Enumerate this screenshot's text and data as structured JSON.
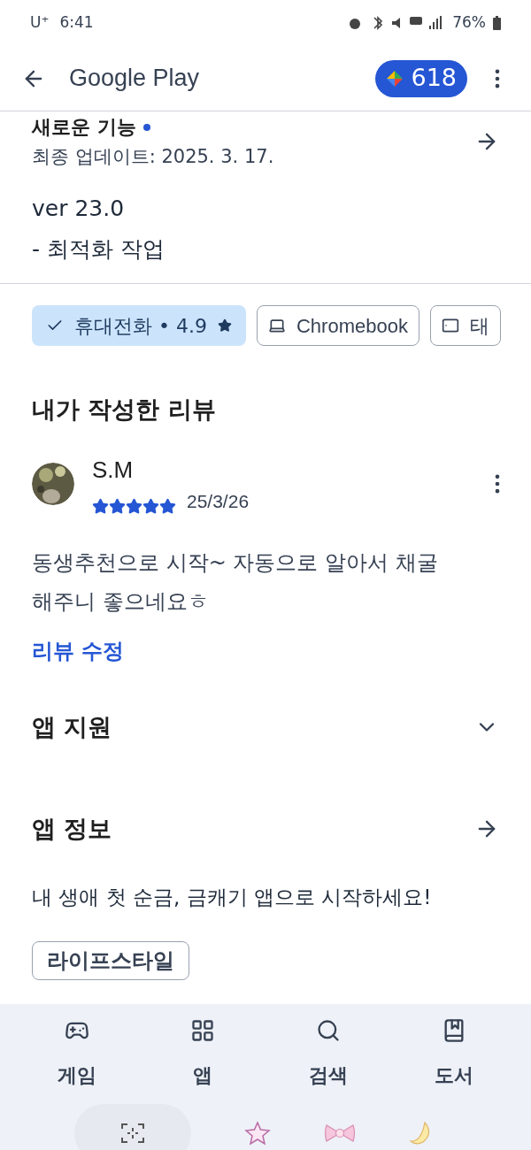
{
  "status_bar": {
    "carrier": "U⁺",
    "time": "6:41",
    "battery": "76%"
  },
  "header": {
    "title": "Google Play",
    "points": "618"
  },
  "whats_new": {
    "title": "새로운 기능",
    "updated": "최종 업데이트: 2025. 3. 17.",
    "notes": [
      "ver 23.0",
      "- 최적화 작업"
    ]
  },
  "device_chips": [
    {
      "kind": "phone",
      "label": "휴대전화 • 4.9",
      "selected": true
    },
    {
      "kind": "laptop",
      "label": "Chromebook",
      "selected": false
    },
    {
      "kind": "tablet",
      "label": "태",
      "selected": false
    }
  ],
  "my_review": {
    "heading": "내가 작성한 리뷰",
    "author": "S.M",
    "stars": 5,
    "date": "25/3/26",
    "text": "동생추천으로 시작~ 자동으로 알아서 채굴해주니 좋으네요ㅎ",
    "edit_link": "리뷰 수정"
  },
  "sections": [
    {
      "kind": "expand",
      "title": "앱 지원"
    },
    {
      "kind": "link",
      "title": "앱 정보"
    }
  ],
  "app_description": "내 생애 첫 순금, 금캐기 앱으로 시작하세요!",
  "category_chip": "라이프스타일",
  "bottom_nav": [
    {
      "kind": "games",
      "label": "게임"
    },
    {
      "kind": "apps",
      "label": "앱"
    },
    {
      "kind": "search",
      "label": "검색"
    },
    {
      "kind": "books",
      "label": "도서"
    }
  ]
}
